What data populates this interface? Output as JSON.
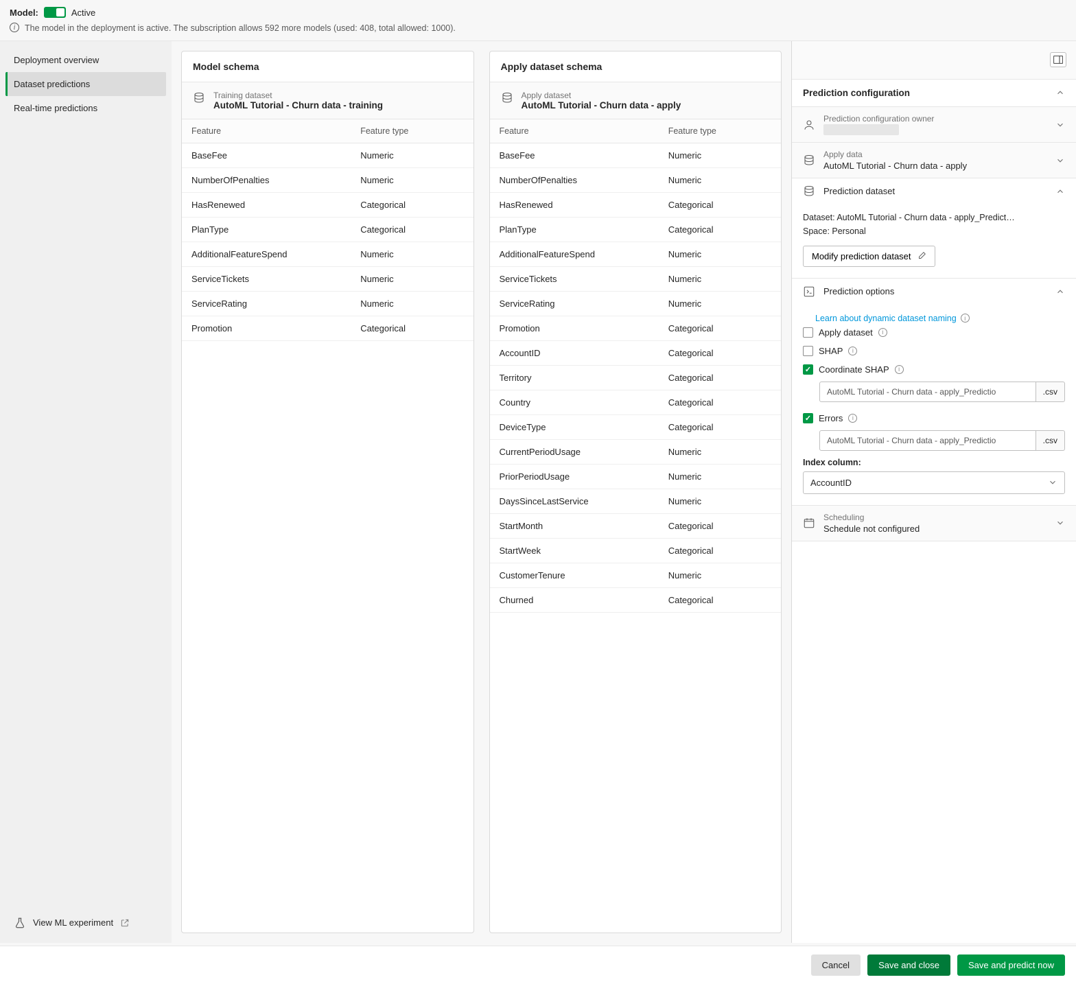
{
  "header": {
    "model_label": "Model:",
    "active_label": "Active",
    "info_text": "The model in the deployment is active. The subscription allows 592 more models (used: 408, total allowed: 1000)."
  },
  "sidebar": {
    "items": [
      {
        "label": "Deployment overview",
        "active": false
      },
      {
        "label": "Dataset predictions",
        "active": true
      },
      {
        "label": "Real-time predictions",
        "active": false
      }
    ],
    "footer_label": "View ML experiment"
  },
  "model_schema": {
    "title": "Model schema",
    "dataset_label": "Training dataset",
    "dataset_name": "AutoML Tutorial - Churn data - training",
    "columns": [
      "Feature",
      "Feature type"
    ],
    "rows": [
      [
        "BaseFee",
        "Numeric"
      ],
      [
        "NumberOfPenalties",
        "Numeric"
      ],
      [
        "HasRenewed",
        "Categorical"
      ],
      [
        "PlanType",
        "Categorical"
      ],
      [
        "AdditionalFeatureSpend",
        "Numeric"
      ],
      [
        "ServiceTickets",
        "Numeric"
      ],
      [
        "ServiceRating",
        "Numeric"
      ],
      [
        "Promotion",
        "Categorical"
      ]
    ]
  },
  "apply_schema": {
    "title": "Apply dataset schema",
    "dataset_label": "Apply dataset",
    "dataset_name": "AutoML Tutorial - Churn data - apply",
    "columns": [
      "Feature",
      "Feature type"
    ],
    "rows": [
      [
        "BaseFee",
        "Numeric"
      ],
      [
        "NumberOfPenalties",
        "Numeric"
      ],
      [
        "HasRenewed",
        "Categorical"
      ],
      [
        "PlanType",
        "Categorical"
      ],
      [
        "AdditionalFeatureSpend",
        "Numeric"
      ],
      [
        "ServiceTickets",
        "Numeric"
      ],
      [
        "ServiceRating",
        "Numeric"
      ],
      [
        "Promotion",
        "Categorical"
      ],
      [
        "AccountID",
        "Categorical"
      ],
      [
        "Territory",
        "Categorical"
      ],
      [
        "Country",
        "Categorical"
      ],
      [
        "DeviceType",
        "Categorical"
      ],
      [
        "CurrentPeriodUsage",
        "Numeric"
      ],
      [
        "PriorPeriodUsage",
        "Numeric"
      ],
      [
        "DaysSinceLastService",
        "Numeric"
      ],
      [
        "StartMonth",
        "Categorical"
      ],
      [
        "StartWeek",
        "Categorical"
      ],
      [
        "CustomerTenure",
        "Numeric"
      ],
      [
        "Churned",
        "Categorical"
      ]
    ]
  },
  "right": {
    "title": "Prediction configuration",
    "owner": {
      "label": "Prediction configuration owner"
    },
    "apply_data": {
      "label": "Apply data",
      "value": "AutoML Tutorial - Churn data - apply"
    },
    "dataset": {
      "label": "Prediction dataset",
      "kv_dataset": "Dataset: AutoML Tutorial - Churn data - apply_Predict…",
      "kv_space": "Space: Personal",
      "modify_label": "Modify prediction dataset"
    },
    "options": {
      "label": "Prediction options",
      "learn_link": "Learn about dynamic dataset naming",
      "apply_dataset_label": "Apply dataset",
      "shap_label": "SHAP",
      "coord_shap_label": "Coordinate SHAP",
      "coord_file": "AutoML Tutorial - Churn data - apply_Predictio",
      "errors_label": "Errors",
      "errors_file": "AutoML Tutorial - Churn data - apply_Predictio",
      "ext": ".csv",
      "index_label": "Index column:",
      "index_value": "AccountID"
    },
    "scheduling": {
      "label": "Scheduling",
      "value": "Schedule not configured"
    }
  },
  "footer": {
    "cancel": "Cancel",
    "save_close": "Save and close",
    "save_predict": "Save and predict now"
  }
}
